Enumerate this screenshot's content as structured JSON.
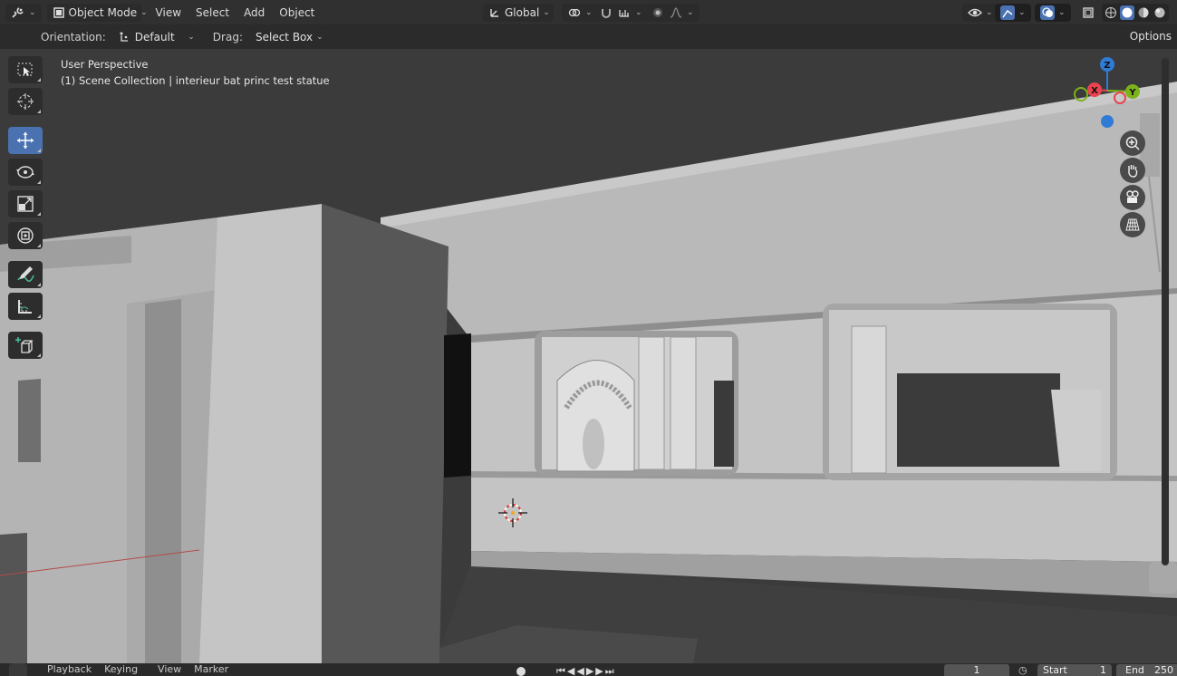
{
  "header": {
    "mode_label": "Object Mode",
    "menus": [
      "View",
      "Select",
      "Add",
      "Object"
    ],
    "transform_orientation": "Global"
  },
  "tool_header": {
    "orientation_label": "Orientation:",
    "orientation_value": "Default",
    "drag_label": "Drag:",
    "drag_value": "Select Box",
    "options_label": "Options"
  },
  "viewport": {
    "perspective_label": "User Perspective",
    "collection_label": "(1) Scene Collection | interieur bat princ test statue",
    "gizmo": {
      "x": "X",
      "y": "Y",
      "z": "Z"
    }
  },
  "timeline": {
    "playback_label": "Playback",
    "keying_label": "Keying",
    "view_label": "View",
    "marker_label": "Marker",
    "current_frame": "1",
    "start_label": "Start",
    "start_value": "1",
    "end_label": "End",
    "end_value": "250"
  },
  "colors": {
    "accent": "#4a72b0",
    "axis_x": "#e8434e",
    "axis_y": "#7cb31b",
    "axis_z": "#2f7bd6"
  }
}
